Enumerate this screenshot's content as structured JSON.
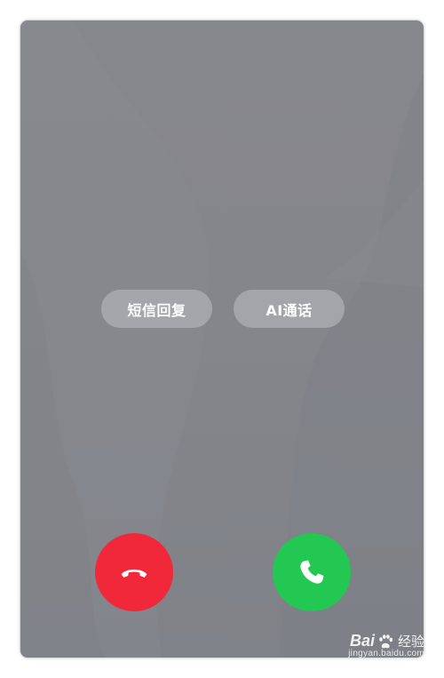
{
  "incoming_call": {
    "quick_actions": [
      {
        "label": "短信回复",
        "icon": "sms-reply"
      },
      {
        "label": "AI通话",
        "icon": "ai-call"
      }
    ],
    "decline": {
      "icon": "phone-hangup-icon",
      "color": "#f0283a"
    },
    "accept": {
      "icon": "phone-answer-icon",
      "color": "#22c852"
    }
  },
  "watermark": {
    "brand": "Bai",
    "name": "经验",
    "url": "jingyan.baidu.com",
    "icon": "baidu-paw-icon"
  },
  "colors": {
    "background": "#85868c",
    "pill": "#b3b4b9",
    "text": "#ffffff"
  }
}
